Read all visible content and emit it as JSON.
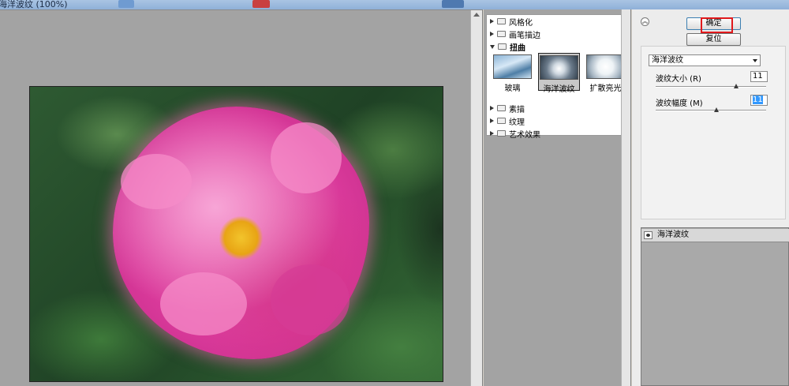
{
  "window": {
    "title": "海洋波纹 (100%)"
  },
  "gallery": {
    "categories": [
      {
        "label": "风格化",
        "expanded": false
      },
      {
        "label": "画笔描边",
        "expanded": false
      },
      {
        "label": "扭曲",
        "expanded": true
      },
      {
        "label": "素描",
        "expanded": false
      },
      {
        "label": "纹理",
        "expanded": false
      },
      {
        "label": "艺术效果",
        "expanded": false
      }
    ],
    "thumbnails": [
      {
        "label": "玻璃",
        "selected": false
      },
      {
        "label": "海洋波纹",
        "selected": true
      },
      {
        "label": "扩散亮光",
        "selected": false
      }
    ]
  },
  "buttons": {
    "ok": "确定",
    "reset": "复位"
  },
  "filter_select": {
    "value": "海洋波纹"
  },
  "params": [
    {
      "label": "波纹大小 (R)",
      "value": "11",
      "slider_fraction": 0.73
    },
    {
      "label": "波纹幅度 (M)",
      "value": "11",
      "slider_fraction": 0.55
    }
  ],
  "effect_layers": [
    {
      "name": "海洋波纹"
    }
  ],
  "colors": {
    "highlight": "#e0191c",
    "preview_bg": "#a3a3a3"
  }
}
